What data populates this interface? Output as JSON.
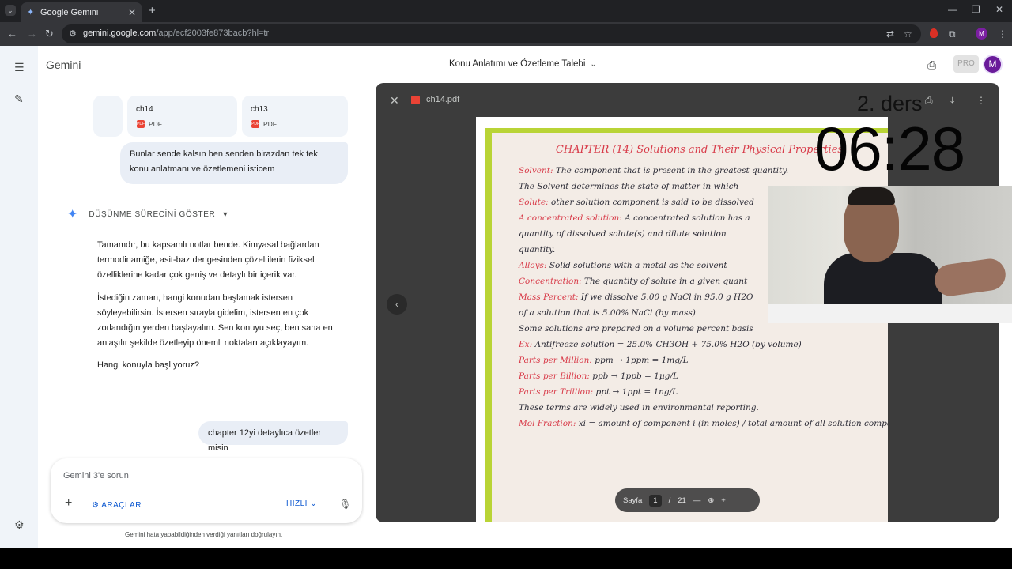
{
  "browser": {
    "tab_title": "Google Gemini",
    "url_host": "gemini.google.com",
    "url_path": "/app/ecf2003fe873bacb?hl=tr",
    "profile_initial": "M"
  },
  "header": {
    "brand": "Gemini",
    "conversation_title": "Konu Anlatımı ve Özetleme Talebi",
    "pro_label": "PRO",
    "avatar_initial": "M"
  },
  "chat": {
    "attachments": [
      {
        "name": "ch14",
        "type": "PDF"
      },
      {
        "name": "ch13",
        "type": "PDF"
      }
    ],
    "user_message_1": "Bunlar sende kalsın ben senden birazdan tek tek konu anlatmanı ve özetlemeni isticem",
    "thinking_label": "DÜŞÜNME SÜRECİNİ GÖSTER",
    "answer": [
      "Tamamdır, bu kapsamlı notlar bende. Kimyasal bağlardan termodinamiğe, asit-baz dengesinden çözeltilerin fiziksel özelliklerine kadar çok geniş ve detaylı bir içerik var.",
      "İstediğin zaman, hangi konudan başlamak istersen söyleyebilirsin. İstersen sırayla gidelim, istersen en çok zorlandığın yerden başlayalım. Sen konuyu seç, ben sana en anlaşılır şekilde özetleyip önemli noktaları açıklayayım.",
      "Hangi konuyla başlıyoruz?"
    ],
    "user_message_2": "chapter 12yi detaylıca özetler misin"
  },
  "composer": {
    "placeholder": "Gemini 3'e sorun",
    "tools_label": "ARAÇLAR",
    "speed_label": "HIZLI",
    "disclaimer": "Gemini hata yapabildiğinden verdiği yanıtları doğrulayın."
  },
  "viewer": {
    "file_name": "ch14.pdf",
    "pager_label": "Sayfa",
    "current_page": "1",
    "separator": "/",
    "total_pages": "21",
    "notes": {
      "heading": "CHAPTER (14) Solutions and Their Physical Properties",
      "lines": [
        {
          "term": "Solvent:",
          "text": " The component that is present in the greatest quantity."
        },
        {
          "term": "",
          "text": "The Solvent determines the state of matter in which"
        },
        {
          "term": "Solute:",
          "text": " other solution component is said to be dissolved"
        },
        {
          "term": "A concentrated solution:",
          "text": " A concentrated solution has a"
        },
        {
          "term": "",
          "text": "quantity of dissolved solute(s) and dilute solution"
        },
        {
          "term": "",
          "text": "quantity."
        },
        {
          "term": "Alloys:",
          "text": " Solid solutions with a metal as the solvent"
        },
        {
          "term": "Concentration:",
          "text": " The quantity of solute in a given quant"
        },
        {
          "term": "Mass Percent:",
          "text": " If we dissolve 5.00 g NaCl in 95.0 g H2O"
        },
        {
          "term": "",
          "text": "of a solution that is 5.00% NaCl (by mass)"
        },
        {
          "term": "",
          "text": "Some solutions are prepared on a volume percent basis"
        },
        {
          "term": "Ex:",
          "text": " Antifreeze solution = 25.0% CH3OH + 75.0% H2O (by volume)"
        },
        {
          "term": "Parts per Million:",
          "text": " ppm → 1ppm = 1mg/L"
        },
        {
          "term": "Parts per Billion:",
          "text": " ppb → 1ppb = 1µg/L"
        },
        {
          "term": "Parts per Trillion:",
          "text": " ppt → 1ppt = 1ng/L"
        },
        {
          "term": "",
          "text": "These terms are widely used in environmental reporting."
        },
        {
          "term": "Mol Fraction:",
          "text": " xi = amount of component i (in moles) / total amount of all solution components (in moles)"
        }
      ]
    }
  },
  "overlay": {
    "label": "2. ders",
    "timer": "06:28"
  }
}
